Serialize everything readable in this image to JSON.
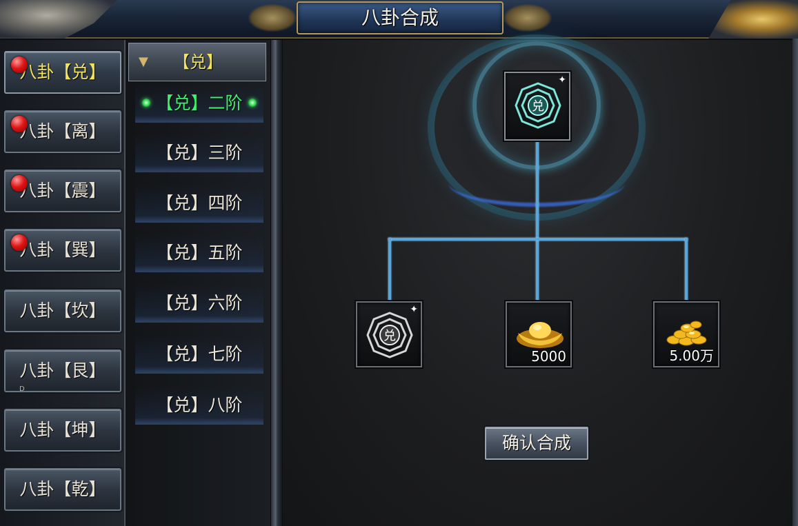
{
  "window": {
    "title": "八卦合成"
  },
  "categories": [
    {
      "label": "八卦【兑】",
      "alert": true,
      "active": true
    },
    {
      "label": "八卦【离】",
      "alert": true,
      "active": false
    },
    {
      "label": "八卦【震】",
      "alert": true,
      "active": false
    },
    {
      "label": "八卦【巽】",
      "alert": true,
      "active": false
    },
    {
      "label": "八卦【坎】",
      "alert": false,
      "active": false
    },
    {
      "label": "八卦【艮】",
      "alert": false,
      "active": false
    },
    {
      "label": "八卦【坤】",
      "alert": false,
      "active": false
    },
    {
      "label": "八卦【乾】",
      "alert": false,
      "active": false
    }
  ],
  "stray_label": "D",
  "tiers": {
    "header": "【兑】",
    "items": [
      {
        "label": "【兑】二阶",
        "selected": true
      },
      {
        "label": "【兑】三阶",
        "selected": false
      },
      {
        "label": "【兑】四阶",
        "selected": false
      },
      {
        "label": "【兑】五阶",
        "selected": false
      },
      {
        "label": "【兑】六阶",
        "selected": false
      },
      {
        "label": "【兑】七阶",
        "selected": false
      },
      {
        "label": "【兑】八阶",
        "selected": false
      }
    ]
  },
  "recipe": {
    "result": {
      "glyph": "兑",
      "icon": "bagua-jade-icon"
    },
    "ingredients": [
      {
        "glyph": "兑",
        "icon": "bagua-silver-icon",
        "count": ""
      },
      {
        "icon": "gold-ingot-icon",
        "count": "5000"
      },
      {
        "icon": "gold-coins-icon",
        "count": "5.00万"
      }
    ]
  },
  "actions": {
    "confirm_label": "确认合成"
  },
  "colors": {
    "active_category": "#f2e35a",
    "selected_tier": "#3ff06b",
    "connector": "#5aa6d8"
  }
}
